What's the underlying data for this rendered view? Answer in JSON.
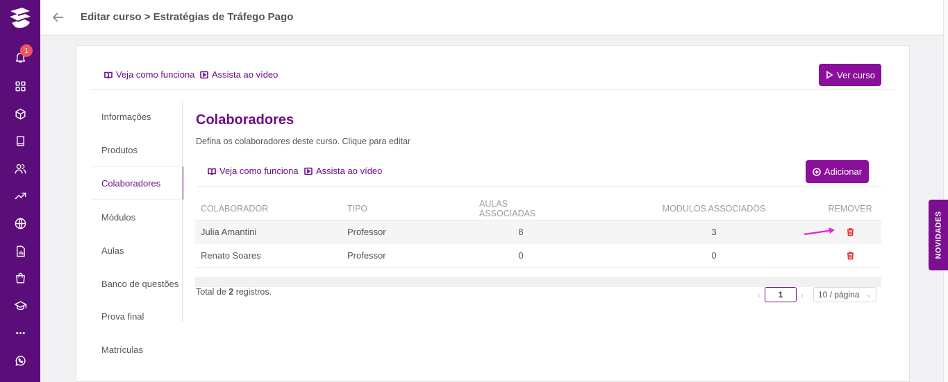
{
  "header": {
    "breadcrumb": "Editar curso > Estratégias de Tráfego Pago"
  },
  "rail": {
    "notification_count": "1",
    "icons": [
      "bell-icon",
      "grid-icon",
      "cube-icon",
      "book-icon",
      "users-icon",
      "trending-icon",
      "globe-icon",
      "report-icon",
      "shopping-bag-icon",
      "graduation-cap-icon",
      "more-icon",
      "whatsapp-icon"
    ]
  },
  "top_links": {
    "how_it_works": "Veja como funciona",
    "watch_video": "Assista ao vídeo",
    "view_course": "Ver curso"
  },
  "menu": {
    "items": [
      "Informações",
      "Produtos",
      "Colaboradores",
      "Módulos",
      "Aulas",
      "Banco de questões",
      "Prova final",
      "Matrículas"
    ],
    "active": "Colaboradores"
  },
  "section": {
    "title": "Colaboradores",
    "subtitle": "Defina os colaboradores deste curso. Clique para editar",
    "how_it_works": "Veja como funciona",
    "watch_video": "Assista ao vídeo",
    "add_button": "Adicionar"
  },
  "table": {
    "columns": [
      "COLABORADOR",
      "TIPO",
      "AULAS ASSOCIADAS",
      "MODULOS ASSOCIADOS",
      "REMOVER"
    ],
    "rows": [
      {
        "name": "Julia Amantini",
        "type": "Professor",
        "lessons": "8",
        "modules": "3"
      },
      {
        "name": "Renato Soares",
        "type": "Professor",
        "lessons": "0",
        "modules": "0"
      }
    ]
  },
  "pagination": {
    "total_prefix": "Total de ",
    "total_count": "2",
    "total_suffix": " registros.",
    "current_page": "1",
    "page_size": "10 / página"
  },
  "novidades": "NOVIDADES",
  "colors": {
    "brand": "#5b0e7a",
    "accent": "#8a0f9a",
    "danger": "#e5343c",
    "annotation": "#ee1fd0"
  }
}
